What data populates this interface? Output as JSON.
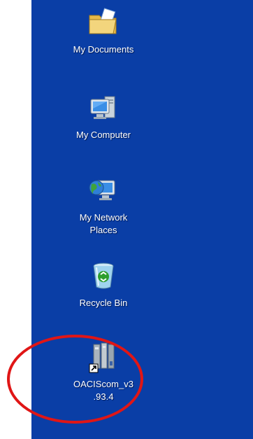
{
  "desktop": {
    "background": "#0a3ea6",
    "icons": [
      {
        "label": "My Documents",
        "icon": "folder-icon"
      },
      {
        "label": "My Computer",
        "icon": "computer-icon"
      },
      {
        "label": "My Network\nPlaces",
        "icon": "network-icon"
      },
      {
        "label": "Recycle Bin",
        "icon": "recycle-bin-icon"
      },
      {
        "label": "OACIScom_v3\n.93.4",
        "icon": "application-shortcut-icon"
      }
    ]
  },
  "annotation": {
    "ring_color": "#e01616"
  }
}
